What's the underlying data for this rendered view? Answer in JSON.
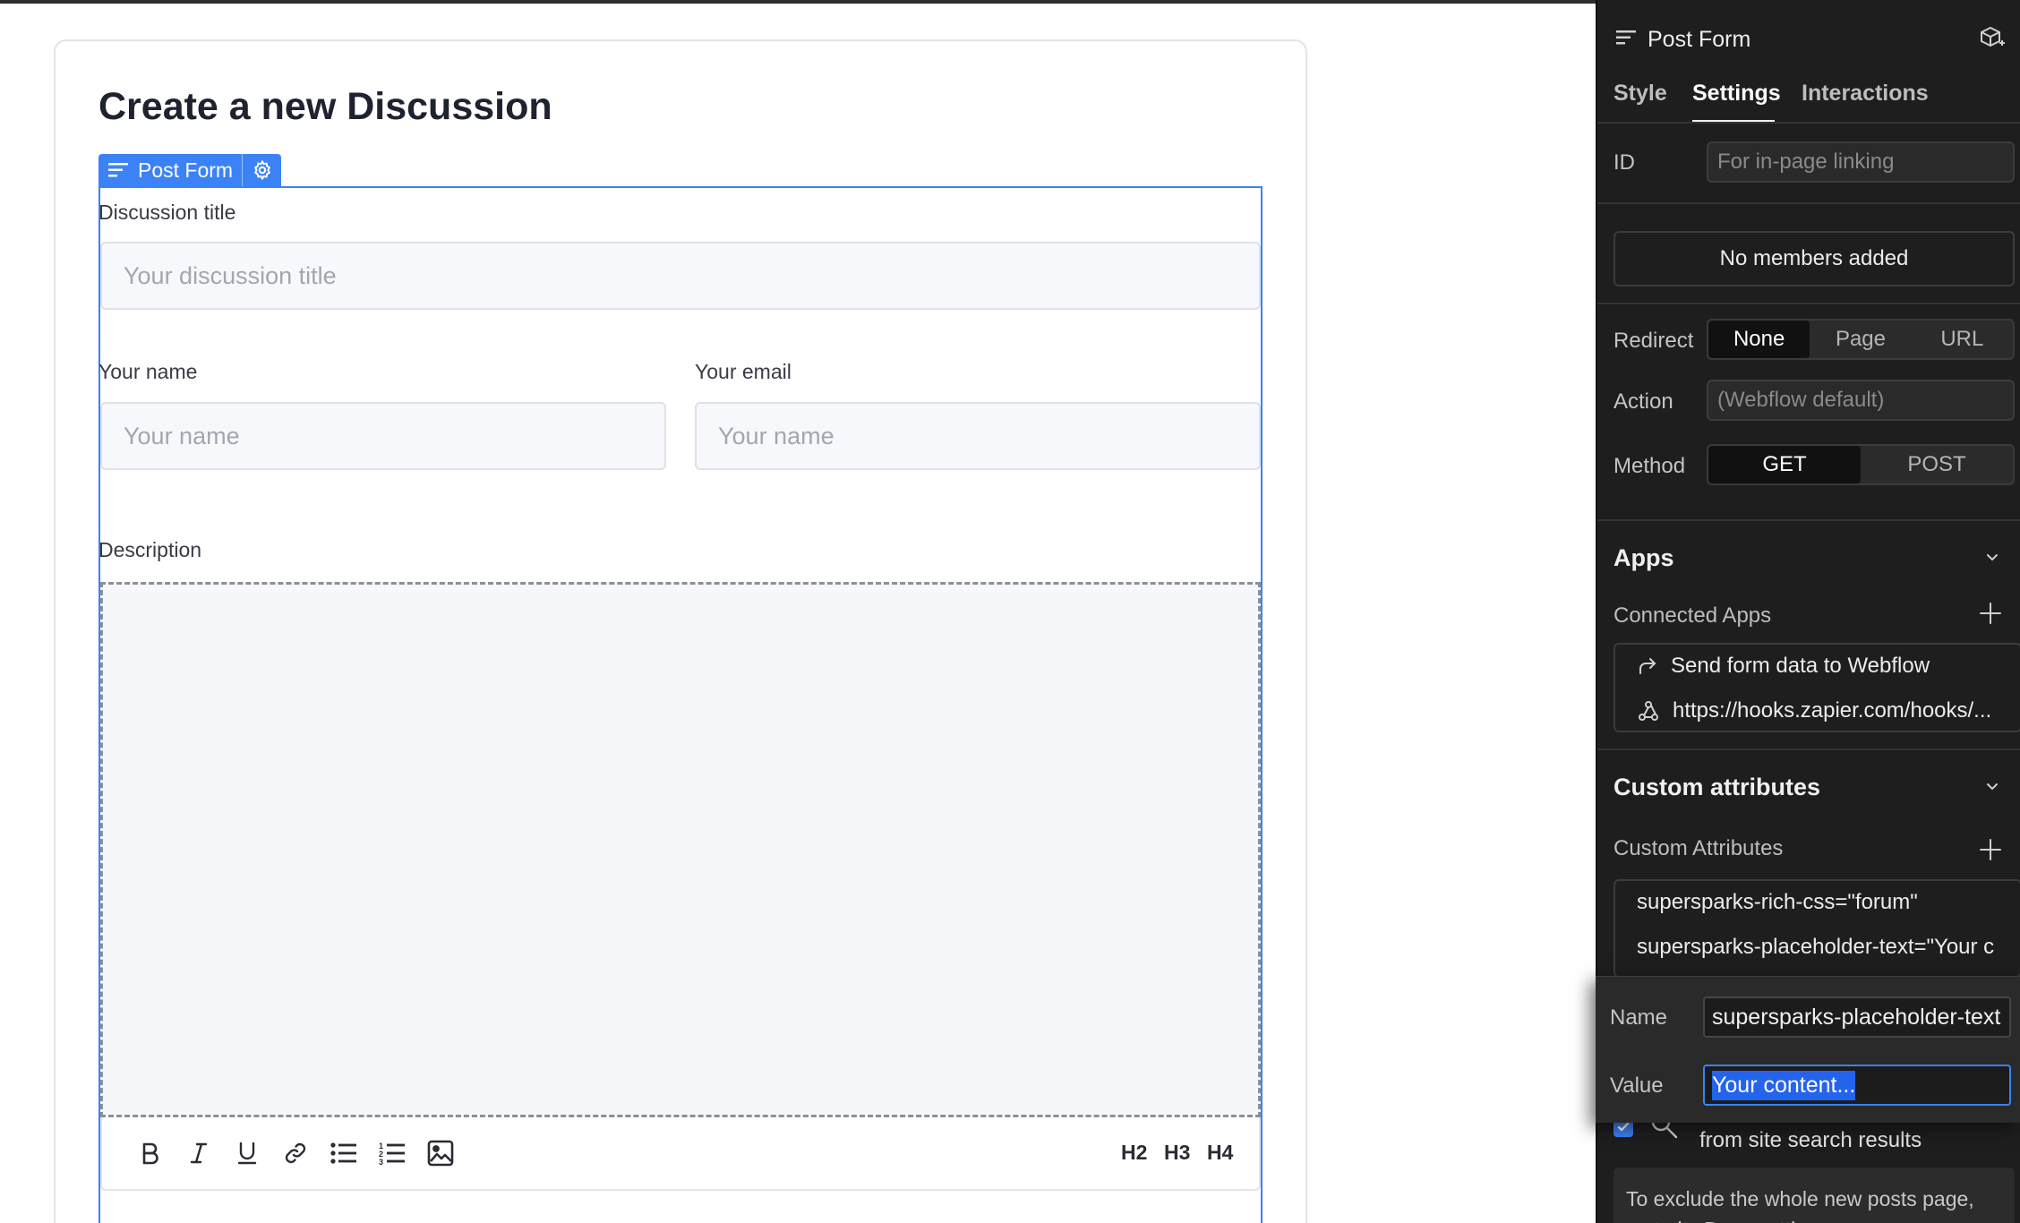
{
  "canvas": {
    "page_title": "Create a new Discussion",
    "form_tag": {
      "label": "Post Form"
    },
    "fields": {
      "discussion_title": {
        "label": "Discussion title",
        "placeholder": "Your discussion title"
      },
      "your_name": {
        "label": "Your name",
        "placeholder": "Your name"
      },
      "your_email": {
        "label": "Your email",
        "placeholder": "Your name"
      },
      "description": {
        "label": "Description"
      }
    },
    "toolbar": {
      "buttons": [
        "bold",
        "italic",
        "underline",
        "link",
        "bulleted-list",
        "numbered-list",
        "image"
      ],
      "headings": [
        "H2",
        "H3",
        "H4"
      ]
    }
  },
  "panel": {
    "header": {
      "title": "Post Form"
    },
    "tabs": [
      {
        "label": "Style",
        "active": false
      },
      {
        "label": "Settings",
        "active": true
      },
      {
        "label": "Interactions",
        "active": false
      }
    ],
    "id_field": {
      "label": "ID",
      "placeholder": "For in-page linking"
    },
    "members": {
      "label": "No members added"
    },
    "redirect": {
      "label": "Redirect",
      "options": [
        "None",
        "Page",
        "URL"
      ],
      "selected": "None"
    },
    "action": {
      "label": "Action",
      "placeholder": "(Webflow default)"
    },
    "method": {
      "label": "Method",
      "options": [
        "GET",
        "POST"
      ],
      "selected": "GET"
    },
    "apps": {
      "title": "Apps",
      "connected_label": "Connected Apps",
      "items": [
        "Send form data to Webflow",
        "https://hooks.zapier.com/hooks/..."
      ]
    },
    "custom_attributes": {
      "title": "Custom attributes",
      "list_label": "Custom Attributes",
      "items": [
        "supersparks-rich-css=\"forum\"",
        "supersparks-placeholder-text=\"Your c"
      ]
    },
    "popover": {
      "name_label": "Name",
      "name_value": "supersparks-placeholder-text",
      "value_label": "Value",
      "value_value": "Your content..."
    },
    "search": {
      "text": "from site search results",
      "checked": true
    },
    "note": {
      "text": "To exclude the whole new posts page, go to its Page settings."
    },
    "colors": {
      "accent": "#3b82f6",
      "panel_bg": "#1e1e1e",
      "selection": "#2463eb"
    }
  }
}
